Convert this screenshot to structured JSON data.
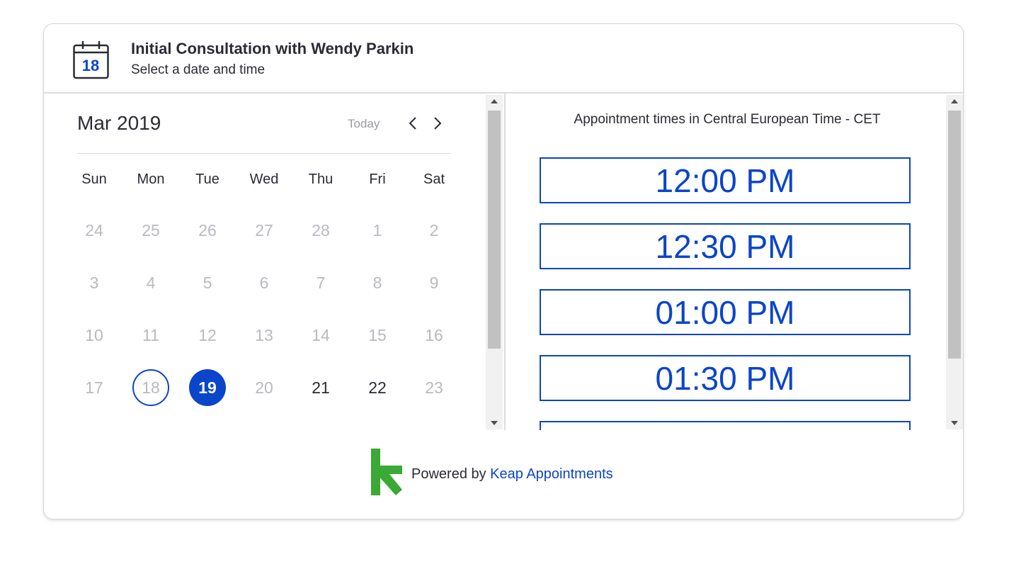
{
  "header": {
    "icon_day": "18",
    "title": "Initial Consultation with Wendy Parkin",
    "subtitle": "Select a date and time"
  },
  "calendar": {
    "month_label": "Mar 2019",
    "today_label": "Today",
    "weekdays": [
      "Sun",
      "Mon",
      "Tue",
      "Wed",
      "Thu",
      "Fri",
      "Sat"
    ],
    "weeks": [
      [
        {
          "d": "24",
          "s": "muted"
        },
        {
          "d": "25",
          "s": "muted"
        },
        {
          "d": "26",
          "s": "muted"
        },
        {
          "d": "27",
          "s": "muted"
        },
        {
          "d": "28",
          "s": "muted"
        },
        {
          "d": "1",
          "s": "disabled"
        },
        {
          "d": "2",
          "s": "disabled"
        }
      ],
      [
        {
          "d": "3",
          "s": "disabled"
        },
        {
          "d": "4",
          "s": "disabled"
        },
        {
          "d": "5",
          "s": "disabled"
        },
        {
          "d": "6",
          "s": "disabled"
        },
        {
          "d": "7",
          "s": "disabled"
        },
        {
          "d": "8",
          "s": "disabled"
        },
        {
          "d": "9",
          "s": "disabled"
        }
      ],
      [
        {
          "d": "10",
          "s": "disabled"
        },
        {
          "d": "11",
          "s": "disabled"
        },
        {
          "d": "12",
          "s": "disabled"
        },
        {
          "d": "13",
          "s": "disabled"
        },
        {
          "d": "14",
          "s": "disabled"
        },
        {
          "d": "15",
          "s": "disabled"
        },
        {
          "d": "16",
          "s": "disabled"
        }
      ],
      [
        {
          "d": "17",
          "s": "disabled"
        },
        {
          "d": "18",
          "s": "today"
        },
        {
          "d": "19",
          "s": "selected"
        },
        {
          "d": "20",
          "s": "disabled"
        },
        {
          "d": "21",
          "s": "available"
        },
        {
          "d": "22",
          "s": "available"
        },
        {
          "d": "23",
          "s": "disabled"
        }
      ]
    ]
  },
  "times": {
    "timezone_label": "Appointment times in Central European Time - CET",
    "slots": [
      "12:00 PM",
      "12:30 PM",
      "01:00 PM",
      "01:30 PM",
      ""
    ]
  },
  "footer": {
    "powered_by": "Powered by ",
    "link_label": "Keap Appointments"
  },
  "colors": {
    "accent": "#0b45c9",
    "logo_green": "#3aa935",
    "muted_text": "#b9b9c0"
  }
}
